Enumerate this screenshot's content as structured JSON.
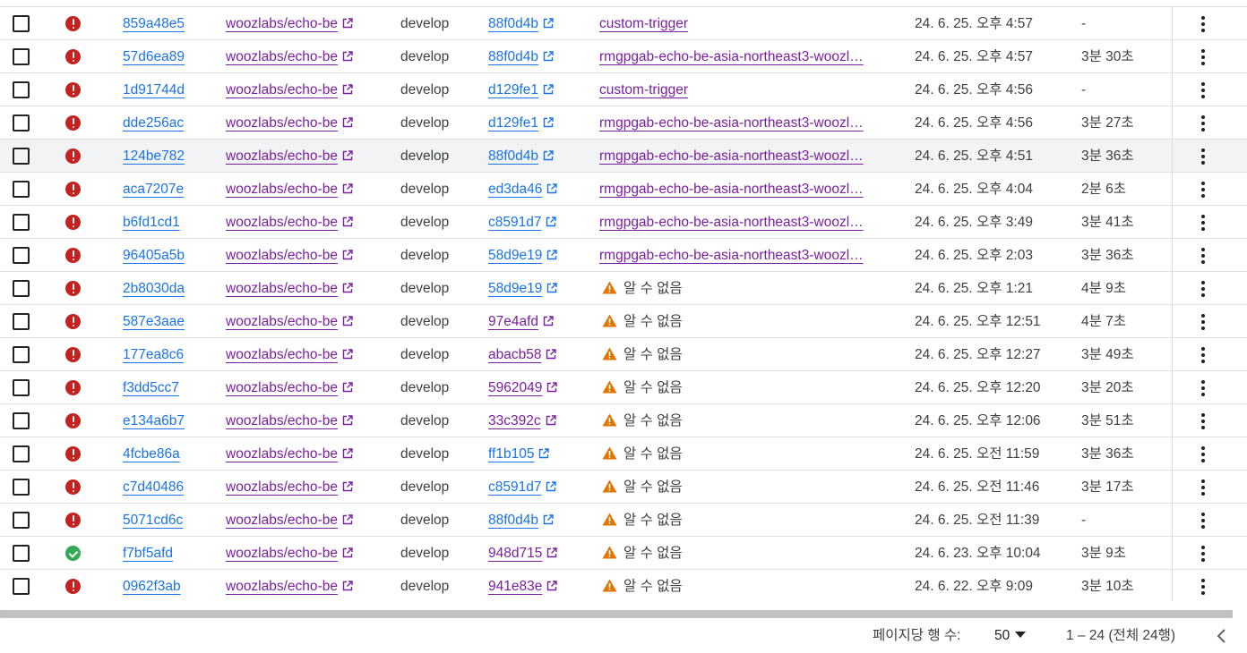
{
  "table": {
    "rows": [
      {
        "status": "error",
        "build_id": "859a48e5",
        "repo": "woozlabs/echo-be",
        "branch": "develop",
        "commit": "88f0d4b",
        "commit_color": "blue",
        "trigger": "custom-trigger",
        "trigger_unknown": false,
        "date": "24. 6. 25. 오후 4:57",
        "duration": "-"
      },
      {
        "status": "error",
        "build_id": "57d6ea89",
        "repo": "woozlabs/echo-be",
        "branch": "develop",
        "commit": "88f0d4b",
        "commit_color": "blue",
        "trigger": "rmgpgab-echo-be-asia-northeast3-woozl…",
        "trigger_unknown": false,
        "date": "24. 6. 25. 오후 4:57",
        "duration": "3분 30초"
      },
      {
        "status": "error",
        "build_id": "1d91744d",
        "repo": "woozlabs/echo-be",
        "branch": "develop",
        "commit": "d129fe1",
        "commit_color": "blue",
        "trigger": "custom-trigger",
        "trigger_unknown": false,
        "date": "24. 6. 25. 오후 4:56",
        "duration": "-"
      },
      {
        "status": "error",
        "build_id": "dde256ac",
        "repo": "woozlabs/echo-be",
        "branch": "develop",
        "commit": "d129fe1",
        "commit_color": "blue",
        "trigger": "rmgpgab-echo-be-asia-northeast3-woozl…",
        "trigger_unknown": false,
        "date": "24. 6. 25. 오후 4:56",
        "duration": "3분 27초"
      },
      {
        "status": "error",
        "build_id": "124be782",
        "repo": "woozlabs/echo-be",
        "branch": "develop",
        "commit": "88f0d4b",
        "commit_color": "blue",
        "trigger": "rmgpgab-echo-be-asia-northeast3-woozl…",
        "trigger_unknown": false,
        "date": "24. 6. 25. 오후 4:51",
        "duration": "3분 36초",
        "hover": true
      },
      {
        "status": "error",
        "build_id": "aca7207e",
        "repo": "woozlabs/echo-be",
        "branch": "develop",
        "commit": "ed3da46",
        "commit_color": "blue",
        "trigger": "rmgpgab-echo-be-asia-northeast3-woozl…",
        "trigger_unknown": false,
        "date": "24. 6. 25. 오후 4:04",
        "duration": "2분 6초"
      },
      {
        "status": "error",
        "build_id": "b6fd1cd1",
        "repo": "woozlabs/echo-be",
        "branch": "develop",
        "commit": "c8591d7",
        "commit_color": "blue",
        "trigger": "rmgpgab-echo-be-asia-northeast3-woozl…",
        "trigger_unknown": false,
        "date": "24. 6. 25. 오후 3:49",
        "duration": "3분 41초"
      },
      {
        "status": "error",
        "build_id": "96405a5b",
        "repo": "woozlabs/echo-be",
        "branch": "develop",
        "commit": "58d9e19",
        "commit_color": "blue",
        "trigger": "rmgpgab-echo-be-asia-northeast3-woozl…",
        "trigger_unknown": false,
        "date": "24. 6. 25. 오후 2:03",
        "duration": "3분 36초"
      },
      {
        "status": "error",
        "build_id": "2b8030da",
        "repo": "woozlabs/echo-be",
        "branch": "develop",
        "commit": "58d9e19",
        "commit_color": "blue",
        "trigger": "알 수 없음",
        "trigger_unknown": true,
        "date": "24. 6. 25. 오후 1:21",
        "duration": "4분 9초"
      },
      {
        "status": "error",
        "build_id": "587e3aae",
        "repo": "woozlabs/echo-be",
        "branch": "develop",
        "commit": "97e4afd",
        "commit_color": "purple",
        "trigger": "알 수 없음",
        "trigger_unknown": true,
        "date": "24. 6. 25. 오후 12:51",
        "duration": "4분 7초"
      },
      {
        "status": "error",
        "build_id": "177ea8c6",
        "repo": "woozlabs/echo-be",
        "branch": "develop",
        "commit": "abacb58",
        "commit_color": "purple",
        "trigger": "알 수 없음",
        "trigger_unknown": true,
        "date": "24. 6. 25. 오후 12:27",
        "duration": "3분 49초"
      },
      {
        "status": "error",
        "build_id": "f3dd5cc7",
        "repo": "woozlabs/echo-be",
        "branch": "develop",
        "commit": "5962049",
        "commit_color": "purple",
        "trigger": "알 수 없음",
        "trigger_unknown": true,
        "date": "24. 6. 25. 오후 12:20",
        "duration": "3분 20초"
      },
      {
        "status": "error",
        "build_id": "e134a6b7",
        "repo": "woozlabs/echo-be",
        "branch": "develop",
        "commit": "33c392c",
        "commit_color": "purple",
        "trigger": "알 수 없음",
        "trigger_unknown": true,
        "date": "24. 6. 25. 오후 12:06",
        "duration": "3분 51초"
      },
      {
        "status": "error",
        "build_id": "4fcbe86a",
        "repo": "woozlabs/echo-be",
        "branch": "develop",
        "commit": "ff1b105",
        "commit_color": "blue",
        "trigger": "알 수 없음",
        "trigger_unknown": true,
        "date": "24. 6. 25. 오전 11:59",
        "duration": "3분 36초"
      },
      {
        "status": "error",
        "build_id": "c7d40486",
        "repo": "woozlabs/echo-be",
        "branch": "develop",
        "commit": "c8591d7",
        "commit_color": "blue",
        "trigger": "알 수 없음",
        "trigger_unknown": true,
        "date": "24. 6. 25. 오전 11:46",
        "duration": "3분 17초"
      },
      {
        "status": "error",
        "build_id": "5071cd6c",
        "repo": "woozlabs/echo-be",
        "branch": "develop",
        "commit": "88f0d4b",
        "commit_color": "blue",
        "trigger": "알 수 없음",
        "trigger_unknown": true,
        "date": "24. 6. 25. 오전 11:39",
        "duration": "-"
      },
      {
        "status": "success",
        "build_id": "f7bf5afd",
        "repo": "woozlabs/echo-be",
        "branch": "develop",
        "commit": "948d715",
        "commit_color": "purple",
        "trigger": "알 수 없음",
        "trigger_unknown": true,
        "date": "24. 6. 23. 오후 10:04",
        "duration": "3분 9초"
      },
      {
        "status": "error",
        "build_id": "0962f3ab",
        "repo": "woozlabs/echo-be",
        "branch": "develop",
        "commit": "941e83e",
        "commit_color": "purple",
        "trigger": "알 수 없음",
        "trigger_unknown": true,
        "date": "24. 6. 22. 오후 9:09",
        "duration": "3분 10초"
      }
    ]
  },
  "icons": {
    "status_error": "error-circle-icon",
    "status_success": "check-circle-icon",
    "external_link": "open-in-new-icon",
    "warning": "warning-triangle-icon",
    "more": "more-vert-icon",
    "prev": "chevron-left-icon"
  },
  "colors": {
    "link_blue": "#1a73e8",
    "link_purple": "#7b1fa2",
    "error": "#c5221f",
    "success": "#34a853",
    "warning": "#e37400"
  },
  "pagination": {
    "rows_per_page_label": "페이지당 행 수:",
    "rows_per_page_value": "50",
    "range_text": "1 – 24 (전체 24행)"
  }
}
